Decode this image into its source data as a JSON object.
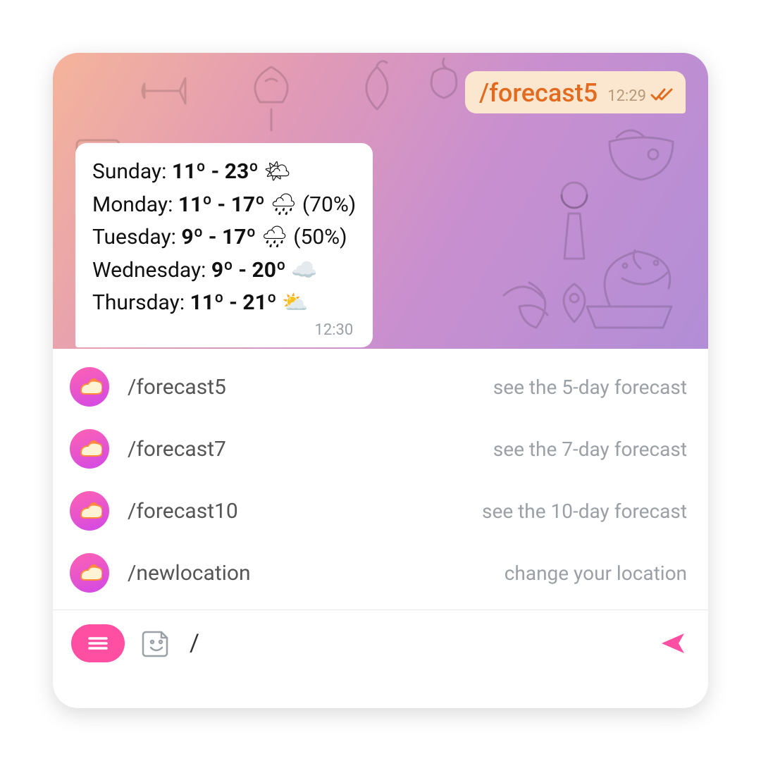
{
  "outgoing": {
    "text": "/forecast5",
    "time": "12:29"
  },
  "incoming": {
    "time": "12:30",
    "lines": [
      {
        "day": "Sunday",
        "range": "11º - 23º",
        "icon": "🌤",
        "extra": ""
      },
      {
        "day": "Monday",
        "range": "11º - 17º",
        "icon": "🌧",
        "extra": " (70%)"
      },
      {
        "day": "Tuesday",
        "range": "9º - 17º",
        "icon": "🌧",
        "extra": " (50%)"
      },
      {
        "day": "Wednesday",
        "range": "9º - 20º",
        "icon": "☁️",
        "extra": ""
      },
      {
        "day": "Thursday",
        "range": "11º - 21º",
        "icon": "⛅",
        "extra": ""
      }
    ]
  },
  "commands": [
    {
      "label": "/forecast5",
      "desc": "see the 5-day forecast"
    },
    {
      "label": "/forecast7",
      "desc": "see the 7-day forecast"
    },
    {
      "label": "/forecast10",
      "desc": "see the 10-day forecast"
    },
    {
      "label": "/newlocation",
      "desc": "change your location"
    }
  ],
  "input": {
    "value": "/"
  }
}
